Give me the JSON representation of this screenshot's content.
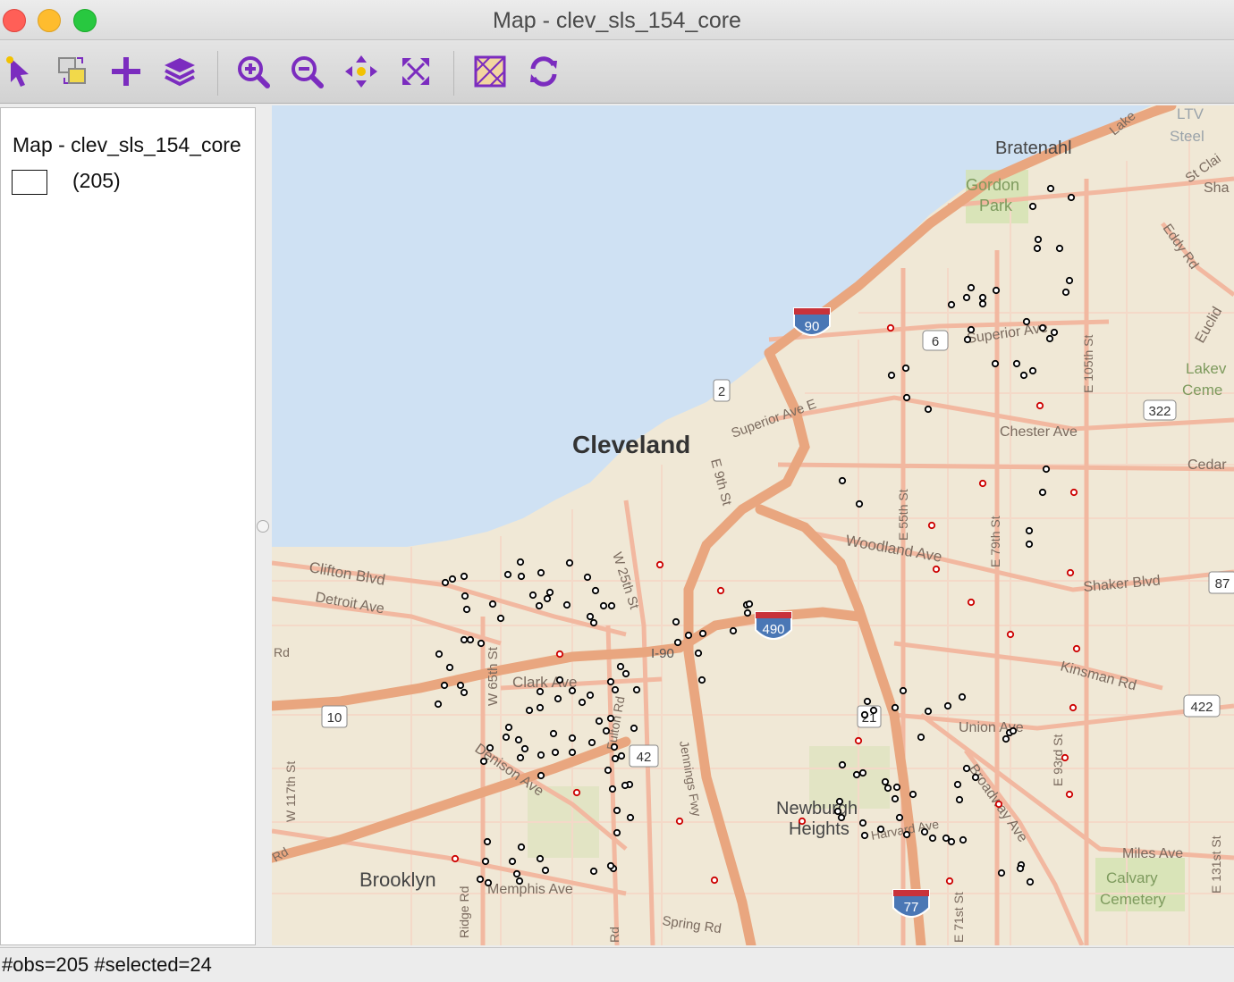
{
  "window": {
    "title": "Map - clev_sls_154_core"
  },
  "toolbar": {
    "tools": [
      {
        "icon": "select-pointer-icon"
      },
      {
        "icon": "copy-image-icon"
      },
      {
        "icon": "add-layer-icon"
      },
      {
        "icon": "layers-icon"
      },
      {
        "icon": "zoom-in-icon"
      },
      {
        "icon": "zoom-out-icon"
      },
      {
        "icon": "pan-icon"
      },
      {
        "icon": "full-extent-icon"
      },
      {
        "icon": "basemap-icon"
      },
      {
        "icon": "refresh-icon"
      }
    ],
    "accent_color": "#7b2cbf"
  },
  "legend": {
    "title": "Map - clev_sls_154_core",
    "category_count": "(205)"
  },
  "map": {
    "labels": {
      "city": "Cleveland",
      "bratenahl": "Bratenahl",
      "gordon": "Gordon",
      "park": "Park",
      "brooklyn": "Brooklyn",
      "newburgh": "Newburgh",
      "heights": "Heights",
      "clifton": "Clifton Blvd",
      "detroit": "Detroit Ave",
      "clark": "Clark Ave",
      "denison": "Denison Ave",
      "memphis": "Memphis Ave",
      "woodland": "Woodland Ave",
      "chester": "Chester Ave",
      "superior": "Superior Ave",
      "superior_e": "Superior Ave E",
      "shaker": "Shaker Blvd",
      "kinsman": "Kinsman Rd",
      "union": "Union Ave",
      "broadway": "Broadway Ave",
      "miles": "Miles Ave",
      "calvary": "Calvary",
      "cemetery": "Cemetery",
      "lakeview": "Lakev",
      "ceme": "Ceme",
      "cedar": "Cedar",
      "eddy": "Eddy Rd",
      "euclid": "Euclid",
      "steel": "Steel",
      "ltv": "LTV",
      "lake": "Lake",
      "stclair": "St Clai",
      "sha": "Sha",
      "e9th": "E 9th St",
      "w25th": "W 25th St",
      "w65th": "W 65th St",
      "w117th": "W 117th St",
      "e55th": "E 55th St",
      "e79th": "E 79th St",
      "e105th": "E 105th St",
      "e93rd": "E 93rd St",
      "e71st": "E 71st St",
      "e131st": "E 131st St",
      "fulton": "Fulton Rd",
      "ridge": "Ridge Rd",
      "jennings": "Jennings Fwy",
      "spring": "Spring Rd",
      "harvard": "Harvard Ave",
      "i90label": "I-90",
      "rd_w": "Rd",
      "rd_w2": "Rd",
      "rd_s": "Rd",
      "shield_90": "90",
      "shield_490": "490",
      "shield_77": "77",
      "shield_2": "2",
      "shield_6": "6",
      "shield_10": "10",
      "shield_21": "21",
      "shield_42": "42",
      "shield_322": "322",
      "shield_87": "87",
      "shield_422": "422"
    },
    "colors": {
      "water": "#cfe1f3",
      "land": "#f0e8d6",
      "highway": "#e9a67f",
      "major_road": "#f2b8a0",
      "selected": "#cc0000",
      "unselected": "#000000"
    },
    "points_unselected": [
      [
        498,
        652
      ],
      [
        519,
        645
      ],
      [
        506,
        648
      ],
      [
        520,
        667
      ],
      [
        522,
        682
      ],
      [
        551,
        676
      ],
      [
        560,
        692
      ],
      [
        568,
        643
      ],
      [
        582,
        629
      ],
      [
        583,
        645
      ],
      [
        596,
        666
      ],
      [
        605,
        641
      ],
      [
        612,
        670
      ],
      [
        603,
        678
      ],
      [
        615,
        663
      ],
      [
        637,
        630
      ],
      [
        634,
        677
      ],
      [
        660,
        690
      ],
      [
        666,
        661
      ],
      [
        664,
        697
      ],
      [
        675,
        678
      ],
      [
        684,
        678
      ],
      [
        657,
        646
      ],
      [
        519,
        716
      ],
      [
        526,
        716
      ],
      [
        538,
        720
      ],
      [
        491,
        732
      ],
      [
        503,
        747
      ],
      [
        497,
        767
      ],
      [
        515,
        767
      ],
      [
        519,
        775
      ],
      [
        490,
        788
      ],
      [
        569,
        814
      ],
      [
        566,
        825
      ],
      [
        580,
        828
      ],
      [
        587,
        838
      ],
      [
        582,
        848
      ],
      [
        592,
        795
      ],
      [
        604,
        792
      ],
      [
        604,
        774
      ],
      [
        626,
        761
      ],
      [
        624,
        782
      ],
      [
        640,
        773
      ],
      [
        651,
        786
      ],
      [
        660,
        778
      ],
      [
        683,
        763
      ],
      [
        688,
        772
      ],
      [
        683,
        804
      ],
      [
        678,
        818
      ],
      [
        709,
        815
      ],
      [
        712,
        772
      ],
      [
        694,
        746
      ],
      [
        700,
        754
      ],
      [
        619,
        821
      ],
      [
        621,
        842
      ],
      [
        640,
        826
      ],
      [
        640,
        842
      ],
      [
        662,
        831
      ],
      [
        670,
        807
      ],
      [
        687,
        836
      ],
      [
        695,
        846
      ],
      [
        688,
        849
      ],
      [
        680,
        862
      ],
      [
        704,
        878
      ],
      [
        699,
        879
      ],
      [
        685,
        883
      ],
      [
        605,
        845
      ],
      [
        605,
        868
      ],
      [
        548,
        837
      ],
      [
        541,
        852
      ],
      [
        690,
        907
      ],
      [
        705,
        915
      ],
      [
        690,
        932
      ],
      [
        545,
        942
      ],
      [
        583,
        948
      ],
      [
        543,
        964
      ],
      [
        573,
        964
      ],
      [
        604,
        961
      ],
      [
        578,
        978
      ],
      [
        581,
        986
      ],
      [
        537,
        984
      ],
      [
        546,
        988
      ],
      [
        610,
        974
      ],
      [
        664,
        975
      ],
      [
        686,
        972
      ],
      [
        683,
        969
      ],
      [
        756,
        696
      ],
      [
        758,
        719
      ],
      [
        770,
        711
      ],
      [
        786,
        709
      ],
      [
        781,
        731
      ],
      [
        785,
        761
      ],
      [
        820,
        706
      ],
      [
        836,
        686
      ],
      [
        835,
        677
      ],
      [
        838,
        676
      ],
      [
        942,
        538
      ],
      [
        961,
        564
      ],
      [
        970,
        785
      ],
      [
        977,
        795
      ],
      [
        967,
        800
      ],
      [
        1010,
        773
      ],
      [
        1001,
        792
      ],
      [
        1038,
        796
      ],
      [
        1060,
        790
      ],
      [
        1076,
        780
      ],
      [
        1030,
        825
      ],
      [
        1125,
        827
      ],
      [
        1129,
        820
      ],
      [
        1133,
        818
      ],
      [
        942,
        856
      ],
      [
        958,
        867
      ],
      [
        965,
        865
      ],
      [
        990,
        875
      ],
      [
        993,
        882
      ],
      [
        1003,
        881
      ],
      [
        1021,
        889
      ],
      [
        1001,
        894
      ],
      [
        939,
        897
      ],
      [
        937,
        908
      ],
      [
        941,
        915
      ],
      [
        965,
        921
      ],
      [
        967,
        935
      ],
      [
        985,
        928
      ],
      [
        1006,
        915
      ],
      [
        1014,
        934
      ],
      [
        1034,
        931
      ],
      [
        1043,
        938
      ],
      [
        1064,
        942
      ],
      [
        1077,
        940
      ],
      [
        1058,
        938
      ],
      [
        1071,
        878
      ],
      [
        1073,
        895
      ],
      [
        1081,
        860
      ],
      [
        1091,
        870
      ],
      [
        1120,
        977
      ],
      [
        1142,
        968
      ],
      [
        1141,
        972
      ],
      [
        1152,
        987
      ],
      [
        1064,
        341
      ],
      [
        1081,
        333
      ],
      [
        1086,
        322
      ],
      [
        1099,
        333
      ],
      [
        1099,
        340
      ],
      [
        1114,
        325
      ],
      [
        1113,
        407
      ],
      [
        1137,
        407
      ],
      [
        1145,
        420
      ],
      [
        1155,
        415
      ],
      [
        1148,
        360
      ],
      [
        1174,
        379
      ],
      [
        1166,
        367
      ],
      [
        1179,
        372
      ],
      [
        1082,
        380
      ],
      [
        1086,
        369
      ],
      [
        1013,
        412
      ],
      [
        997,
        420
      ],
      [
        1014,
        445
      ],
      [
        1038,
        458
      ],
      [
        1155,
        231
      ],
      [
        1175,
        211
      ],
      [
        1198,
        221
      ],
      [
        1161,
        268
      ],
      [
        1160,
        278
      ],
      [
        1185,
        278
      ],
      [
        1196,
        314
      ],
      [
        1192,
        327
      ],
      [
        1151,
        594
      ],
      [
        1151,
        609
      ],
      [
        1170,
        525
      ],
      [
        1166,
        551
      ]
    ],
    "points_selected": [
      [
        996,
        367
      ],
      [
        1163,
        454
      ],
      [
        1099,
        541
      ],
      [
        1201,
        551
      ],
      [
        1042,
        588
      ],
      [
        1047,
        637
      ],
      [
        1197,
        641
      ],
      [
        1086,
        674
      ],
      [
        1130,
        710
      ],
      [
        1204,
        726
      ],
      [
        1200,
        792
      ],
      [
        1191,
        848
      ],
      [
        1196,
        889
      ],
      [
        1117,
        900
      ],
      [
        960,
        829
      ],
      [
        897,
        919
      ],
      [
        1062,
        986
      ],
      [
        806,
        661
      ],
      [
        738,
        632
      ],
      [
        626,
        732
      ],
      [
        645,
        887
      ],
      [
        760,
        919
      ],
      [
        799,
        985
      ],
      [
        509,
        961
      ]
    ]
  },
  "status": {
    "text": "#obs=205 #selected=24"
  }
}
